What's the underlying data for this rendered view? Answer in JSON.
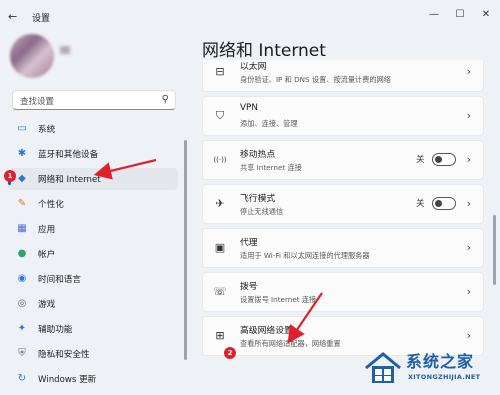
{
  "window": {
    "title": "设置",
    "back_glyph": "←",
    "min_glyph": "—",
    "max_glyph": "☐",
    "close_glyph": "✕"
  },
  "profile": {
    "avatar": "blurred-avatar"
  },
  "search": {
    "placeholder": "查找设置",
    "icon": "search-icon"
  },
  "sidebar": {
    "items": [
      {
        "label": "系统",
        "icon": "monitor-icon",
        "glyph": "▭",
        "color": "#2b78d4"
      },
      {
        "label": "蓝牙和其他设备",
        "icon": "bluetooth-icon",
        "glyph": "✱",
        "color": "#2b78d4"
      },
      {
        "label": "网络和 Internet",
        "icon": "wifi-icon",
        "glyph": "◆",
        "color": "#2b78d4",
        "active": true
      },
      {
        "label": "个性化",
        "icon": "brush-icon",
        "glyph": "✎",
        "color": "#e6792b"
      },
      {
        "label": "应用",
        "icon": "apps-icon",
        "glyph": "▦",
        "color": "#4a6cd6"
      },
      {
        "label": "帐户",
        "icon": "account-icon",
        "glyph": "●",
        "color": "#2fa36b"
      },
      {
        "label": "时间和语言",
        "icon": "globe-clock-icon",
        "glyph": "◉",
        "color": "#2b78d4"
      },
      {
        "label": "游戏",
        "icon": "gamepad-icon",
        "glyph": "◎",
        "color": "#666666"
      },
      {
        "label": "辅助功能",
        "icon": "accessibility-icon",
        "glyph": "✦",
        "color": "#2b78d4"
      },
      {
        "label": "隐私和安全性",
        "icon": "shield-icon",
        "glyph": "⛨",
        "color": "#6b6b6b"
      },
      {
        "label": "Windows 更新",
        "icon": "update-icon",
        "glyph": "↻",
        "color": "#2b78d4"
      }
    ]
  },
  "page": {
    "title": "网络和 Internet"
  },
  "cards": [
    {
      "title": "以太网",
      "subtitle": "身份验证、IP 和 DNS 设置、按流量计费的网络",
      "icon": "ethernet-icon",
      "glyph": "⊟"
    },
    {
      "title": "VPN",
      "subtitle": "添加、连接、管理",
      "icon": "vpn-shield-icon",
      "glyph": "⛉"
    },
    {
      "title": "移动热点",
      "subtitle": "共享 Internet 连接",
      "icon": "hotspot-icon",
      "glyph": "((·))",
      "toggle": "关"
    },
    {
      "title": "飞行模式",
      "subtitle": "停止无线通信",
      "icon": "airplane-icon",
      "glyph": "✈",
      "toggle": "关"
    },
    {
      "title": "代理",
      "subtitle": "适用于 Wi-Fi 和以太网连接的代理服务器",
      "icon": "proxy-icon",
      "glyph": "▣"
    },
    {
      "title": "拨号",
      "subtitle": "设置拨号 Internet 连接",
      "icon": "dialup-icon",
      "glyph": "☏"
    },
    {
      "title": "高级网络设置",
      "subtitle": "查看所有网络适配器，网络重置",
      "icon": "network-adapter-icon",
      "glyph": "⊞"
    }
  ],
  "chevron": "›",
  "badges": {
    "first": "1",
    "second": "2"
  },
  "watermark": {
    "title": "系统之家",
    "subtitle": "XITONGZHIJIA.NET"
  }
}
